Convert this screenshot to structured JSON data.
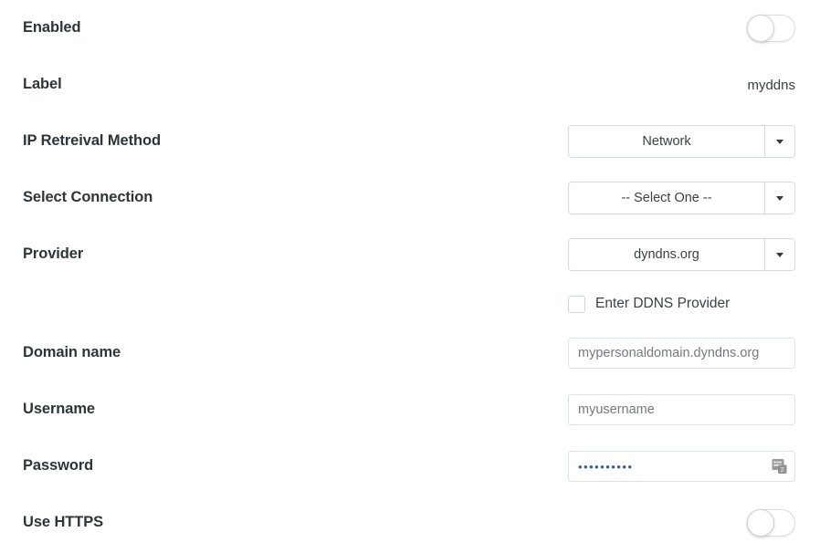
{
  "form": {
    "rows": [
      {
        "label": "Enabled",
        "type": "toggle",
        "state": "off"
      },
      {
        "label": "Label",
        "type": "text",
        "value": "myddns"
      },
      {
        "label": "IP Retreival Method",
        "type": "select",
        "value": "Network"
      },
      {
        "label": "Select Connection",
        "type": "select",
        "value": "-- Select One --"
      },
      {
        "label": "Provider",
        "type": "select",
        "value": "dyndns.org"
      },
      {
        "label": "",
        "type": "checkbox",
        "value": "Enter DDNS Provider",
        "checked": "false"
      },
      {
        "label": "Domain name",
        "type": "input",
        "value": "mypersonaldomain.dyndns.org"
      },
      {
        "label": "Username",
        "type": "input",
        "value": "myusername"
      },
      {
        "label": "Password",
        "type": "password",
        "value": "••••••••••"
      },
      {
        "label": "Use HTTPS",
        "type": "toggle",
        "state": "off"
      }
    ]
  },
  "colors": {
    "label_text": "#2f3437",
    "value_text": "#3c4043",
    "input_text": "#77797c",
    "border": "#d7dadd",
    "background": "#ffffff",
    "password_dots": "#3f5d86"
  },
  "icons": {
    "dropdown": "chevron-down-icon",
    "password_reveal": "password-reveal-icon"
  }
}
